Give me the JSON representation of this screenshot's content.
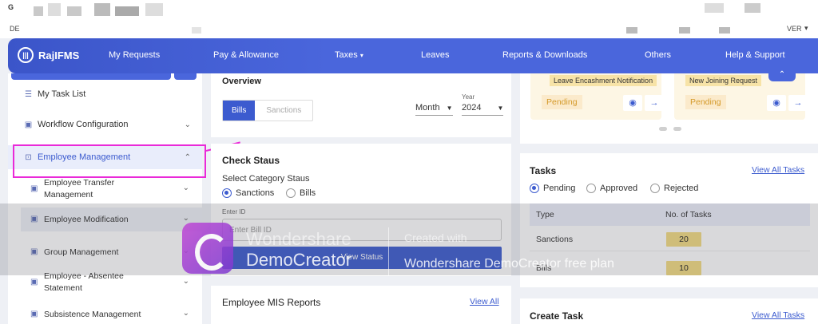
{
  "browser": {
    "left_label": "DE",
    "right_label": "VER"
  },
  "nav": {
    "brand": "RajIFMS",
    "items": [
      "My Requests",
      "Pay & Allowance",
      "Taxes",
      "Leaves",
      "Reports & Downloads",
      "Others",
      "Help & Support"
    ]
  },
  "sidebar": {
    "items": [
      {
        "label": "My Task List"
      },
      {
        "label": "Workflow Configuration"
      },
      {
        "label": "Employee Management"
      }
    ],
    "sub_items": [
      {
        "line1": "Employee Transfer",
        "line2": "Management"
      },
      {
        "line1": "Employee Modification",
        "line2": ""
      },
      {
        "line1": "Group Management",
        "line2": ""
      },
      {
        "line1": "Employee - Absentee",
        "line2": "Statement"
      },
      {
        "line1": "Subsistence Management",
        "line2": ""
      }
    ]
  },
  "overview": {
    "title": "Overview",
    "tab_bills": "Bills",
    "tab_sanctions": "Sanctions",
    "month_label": "Month",
    "year_caption": "Year",
    "year_value": "2024"
  },
  "check_status": {
    "title": "Check Staus",
    "subtitle": "Select Category Staus",
    "opt_sanctions": "Sanctions",
    "opt_bills": "Bills",
    "enter_id_caption": "Enter ID",
    "input_placeholder": "Enter Bill ID",
    "button": "View Status"
  },
  "mis": {
    "title": "Employee MIS Reports",
    "link": "View All"
  },
  "notifications": [
    {
      "tag": "Leave Encashment Notification",
      "status": "Pending"
    },
    {
      "tag": "New Joining Request",
      "status": "Pending"
    }
  ],
  "tasks": {
    "title": "Tasks",
    "link": "View All Tasks",
    "filters": [
      "Pending",
      "Approved",
      "Rejected"
    ],
    "col_type": "Type",
    "col_count": "No. of Tasks",
    "rows": [
      {
        "type": "Sanctions",
        "count": "20"
      },
      {
        "type": "Bills",
        "count": "10"
      }
    ]
  },
  "create_task": {
    "title": "Create Task",
    "link": "View All Tasks"
  },
  "watermark": {
    "brand1": "Wondershare",
    "brand2": "DemoCreator",
    "line1": "Created with",
    "line2": "Wondershare DemoCreator free plan"
  }
}
